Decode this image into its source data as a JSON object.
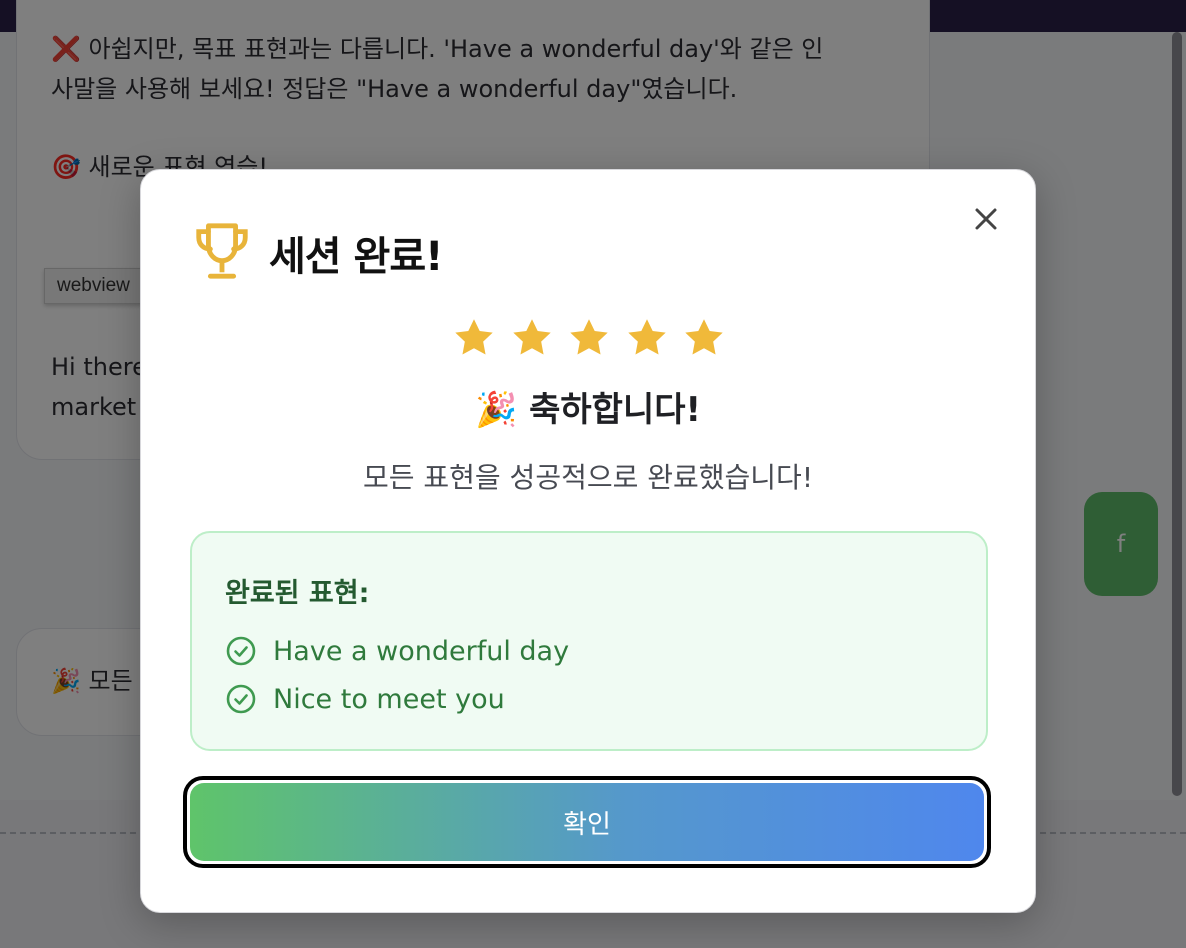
{
  "chat": {
    "message_1_lines": [
      "❌ 아쉽지만, 목표 표현과는 다릅니다. 'Have a wonderful day'와 같은 인",
      "사말을 사용해 보세요! 정답은 \"Have a wonderful day\"였습니다.",
      "🎯 새로운 표현 연습!",
      "Hi there",
      "market"
    ],
    "message_2": "🎉 모든",
    "user_message": "f"
  },
  "tooltip": "webview",
  "modal": {
    "title": "세션 완료!",
    "trophy_icon": "trophy-icon",
    "close_icon": "close-icon",
    "rating": 5,
    "rating_max": 5,
    "star_color": "#f0b93a",
    "congrats": "🎉 축하합니다!",
    "subtitle": "모든 표현을 성공적으로 완료했습니다!",
    "completed_title": "완료된 표현:",
    "completed_phrases": [
      "Have a wonderful day",
      "Nice to meet you"
    ],
    "confirm_label": "확인",
    "colors": {
      "trophy": "#e8b43a",
      "success_text": "#2f7a3c",
      "success_bg": "#f0fbf3",
      "button_start": "#5fc46a",
      "button_end": "#4f87ed"
    }
  }
}
